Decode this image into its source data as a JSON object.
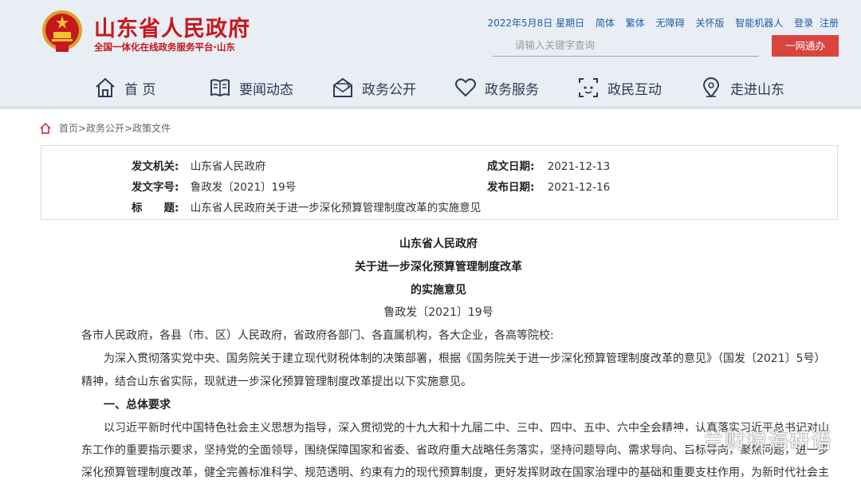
{
  "header": {
    "site_name": "山东省人民政府",
    "site_sub": "全国一体化在线政务服务平台·山东",
    "top_links": [
      "2022年5月8日 星期日",
      "简体",
      "繁体",
      "无障碍",
      "关怀版",
      "智能机器人",
      "登录",
      "注册"
    ],
    "search_placeholder": "请输入关键字查询",
    "search_button": "一网通办"
  },
  "nav": [
    {
      "label": "首 页",
      "icon": "home-icon"
    },
    {
      "label": "要闻动态",
      "icon": "news-icon"
    },
    {
      "label": "政务公开",
      "icon": "open-mail-icon"
    },
    {
      "label": "政务服务",
      "icon": "heart-icon"
    },
    {
      "label": "政民互动",
      "icon": "chat-icon"
    },
    {
      "label": "走进山东",
      "icon": "location-icon"
    }
  ],
  "breadcrumb": "首页>政务公开>政策文件",
  "info": {
    "issuer_label": "发文机关:",
    "issuer": "山东省人民政府",
    "date_made_label": "成文日期:",
    "date_made": "2021-12-13",
    "doc_no_label": "发文字号:",
    "doc_no": "鲁政发〔2021〕19号",
    "date_pub_label": "发布日期:",
    "date_pub": "2021-12-16",
    "title_label": "标　　题:",
    "title": "山东省人民政府关于进一步深化预算管理制度改革的实施意见"
  },
  "document": {
    "title_lines": [
      "山东省人民政府",
      "关于进一步深化预算管理制度改革",
      "的实施意见"
    ],
    "code": "鲁政发〔2021〕19号",
    "addressee": "各市人民政府，各县（市、区）人民政府，省政府各部门、各直属机构，各大企业，各高等院校:",
    "p1_line1": "为深入贯彻落实党中央、国务院关于建立现代财税体制的决策部署，根据《国务院关于进一步深化预算管理制度改革的意见》（国发〔2021〕5号）",
    "p1_line2": "精神，结合山东省实际，现就进一步深化预算管理制度改革提出以下实施意见。",
    "section1": "一、总体要求",
    "p2_line1": "以习近平新时代中国特色社会主义思想为指导，深入贯彻党的十九大和十九届二中、三中、四中、五中、六中全会精神，认真落实习近平总书记对山",
    "p2_line2": "东工作的重要指示要求，坚持党的全面领导，围绕保障国家和省委、省政府重大战略任务落实，坚持问题导向、需求导向、目标导向，聚焦问题，进一步",
    "p2_line3": "深化预算管理制度改革，健全完善标准科学、规范透明、约束有力的现代预算制度，更好发挥财政在国家治理中的基础和重要支柱作用，为新时代社会主"
  },
  "watermark": "兰财税海研语",
  "colors": {
    "brand_red": "#c8161d",
    "link_blue": "#1f5da8",
    "button_red": "#d9443f",
    "header_bg": "#e9eef4"
  }
}
